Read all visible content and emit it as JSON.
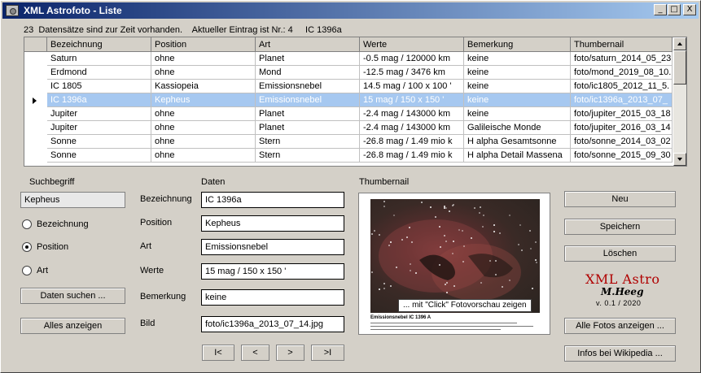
{
  "window": {
    "title": "XML Astrofoto - Liste",
    "icon": "camera-icon",
    "controls": {
      "minimize": "_",
      "maximize": "□",
      "close": "X"
    }
  },
  "status": {
    "text": "23  Datensätze sind zur Zeit vorhanden.    Aktueller Eintrag ist Nr.: 4     IC 1396a"
  },
  "grid": {
    "columns": [
      "Bezeichnung",
      "Position",
      "Art",
      "Werte",
      "Bemerkung",
      "Thumbernail"
    ],
    "rows": [
      [
        "Saturn",
        "ohne",
        "Planet",
        "-0.5 mag  / 120000 km",
        "keine",
        "foto/saturn_2014_05_23"
      ],
      [
        "Erdmond",
        "ohne",
        "Mond",
        "-12.5 mag  /  3476 km",
        "keine",
        "foto/mond_2019_08_10."
      ],
      [
        "IC 1805",
        "Kassiopeia",
        "Emissionsnebel",
        "14.5 mag  /  100 x 100 '",
        "keine",
        "foto/ic1805_2012_11_5."
      ],
      [
        "IC 1396a",
        "Kepheus",
        "Emissionsnebel",
        "15 mag  /  150 x 150 '",
        "keine",
        "foto/ic1396a_2013_07_"
      ],
      [
        "Jupiter",
        "ohne",
        "Planet",
        "-2.4 mag  /  143000 km",
        "keine",
        "foto/jupiter_2015_03_18"
      ],
      [
        "Jupiter",
        "ohne",
        "Planet",
        "-2.4 mag  /  143000 km",
        "Galileische Monde",
        "foto/jupiter_2016_03_14"
      ],
      [
        "Sonne",
        "ohne",
        "Stern",
        "-26.8 mag  /  1.49 mio k",
        "H alpha Gesamtsonne",
        "foto/sonne_2014_03_02"
      ],
      [
        "Sonne",
        "ohne",
        "Stern",
        "-26.8 mag  /  1.49 mio k",
        "H alpha Detail Massena",
        "foto/sonne_2015_09_30"
      ]
    ],
    "selected_index": 3,
    "row_pointer": "▶"
  },
  "search": {
    "heading": "Suchbegriff",
    "value": "Kepheus",
    "options": [
      "Bezeichnung",
      "Position",
      "Art"
    ],
    "selected_option": "Position",
    "find_button": "Daten suchen ...",
    "show_all_button": "Alles anzeigen"
  },
  "details": {
    "heading": "Daten",
    "labels": {
      "bezeichnung": "Bezeichnung",
      "position": "Position",
      "art": "Art",
      "werte": "Werte",
      "bemerkung": "Bemerkung",
      "bild": "Bild"
    },
    "values": {
      "bezeichnung": "IC 1396a",
      "position": "Kepheus",
      "art": "Emissionsnebel",
      "werte": "15 mag  /  150 x 150 '",
      "bemerkung": "keine",
      "bild": "foto/ic1396a_2013_07_14.jpg"
    }
  },
  "navigation": {
    "first": "I<",
    "prev": "<",
    "next": ">",
    "last": ">I"
  },
  "thumbnail": {
    "heading": "Thumbernail",
    "caption": "... mit \"Click\" Fotovorschau  zeigen",
    "doc_title": "Emissionsnebel IC 1396 A"
  },
  "actions": {
    "new": "Neu",
    "save": "Speichern",
    "delete": "Löschen",
    "all_photos": "Alle Fotos anzeigen  ...",
    "wikipedia": "Infos bei Wikipedia  ..."
  },
  "logo": {
    "title": "XML Astro",
    "signature": "M.Heeg",
    "version": "v. 0.1 / 2020"
  },
  "colors": {
    "titlebar_start": "#0a246a",
    "titlebar_end": "#a6caf0",
    "selection": "#a6c8f0",
    "logo_red": "#b00000",
    "face": "#d4d0c8"
  }
}
